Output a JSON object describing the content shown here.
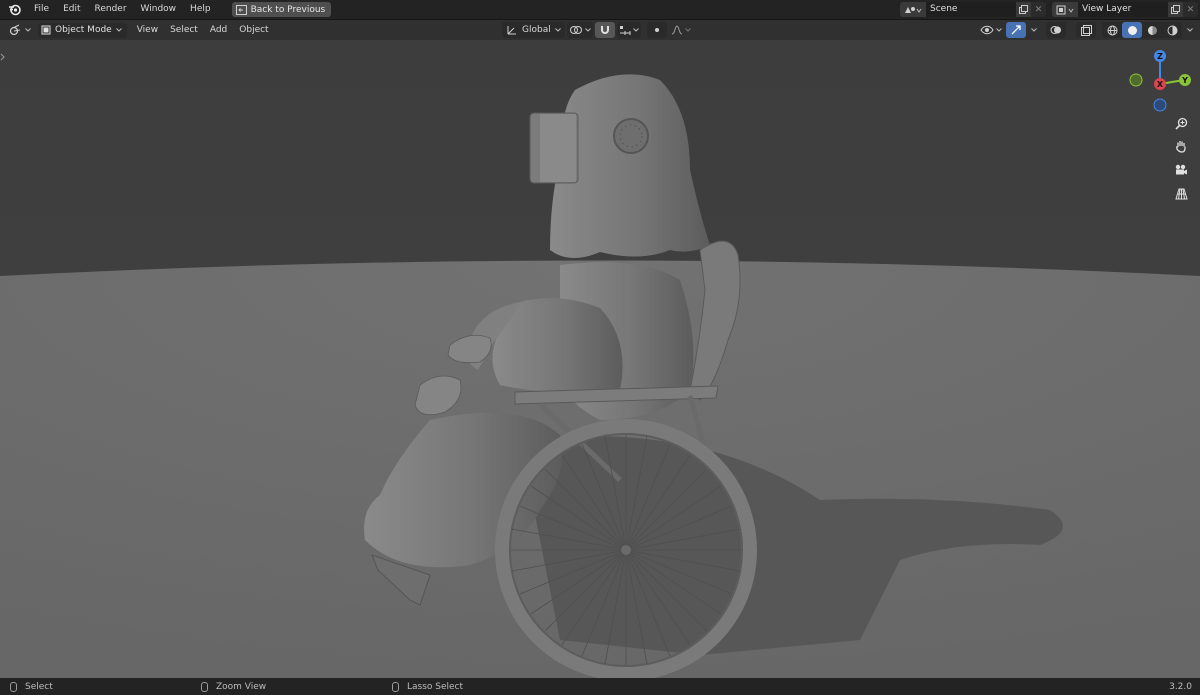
{
  "topbar": {
    "menus": [
      "File",
      "Edit",
      "Render",
      "Window",
      "Help"
    ],
    "back_label": "Back to Previous",
    "scene": "Scene",
    "view_layer": "View Layer"
  },
  "viewport_header": {
    "mode": "Object Mode",
    "menus": [
      "View",
      "Select",
      "Add",
      "Object"
    ],
    "orientation": "Global"
  },
  "gizmo": {
    "z_label": "Z",
    "y_label": "Y",
    "x_label": "X"
  },
  "statusbar": {
    "select": "Select",
    "zoom": "Zoom View",
    "lasso": "Lasso Select",
    "version": "3.2.0"
  },
  "colors": {
    "accent": "#4772b3",
    "axis_x": "#e0444f",
    "axis_y": "#8ac338",
    "axis_z": "#4487e6"
  }
}
